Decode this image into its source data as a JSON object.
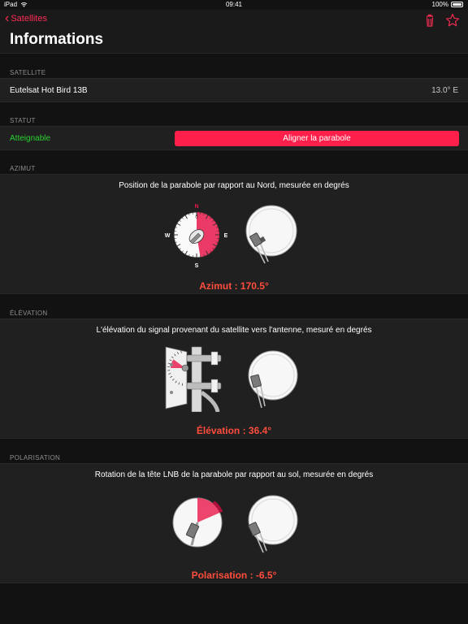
{
  "status_bar": {
    "device": "iPad",
    "time": "09:41",
    "battery": "100%"
  },
  "nav": {
    "back_label": "Satellites",
    "title": "Informations"
  },
  "satellite": {
    "section": "SATELLITE",
    "name": "Eutelsat Hot Bird 13B",
    "position": "13.0° E"
  },
  "status": {
    "section": "STATUT",
    "value": "Atteignable",
    "value_color": "#29d12e",
    "align_button": "Aligner la parabole"
  },
  "azimuth": {
    "section": "AZIMUT",
    "description": "Position de la parabole par rapport au Nord, mesurée en degrés",
    "compass": {
      "n": "N",
      "e": "E",
      "s": "S",
      "w": "W",
      "zero": "0"
    },
    "reading": "Azimut : 170.5°",
    "value_deg": 170.5
  },
  "elevation": {
    "section": "ÉLÉVATION",
    "description": "L'élévation du signal provenant du satellite vers l'antenne, mesuré en degrés",
    "reading": "Élévation : 36.4°",
    "value_deg": 36.4
  },
  "polarization": {
    "section": "POLARISATION",
    "description": "Rotation de la tête LNB de la parabole par rapport au sol, mesurée en degrés",
    "reading": "Polarisation : -6.5°",
    "value_deg": -6.5
  },
  "colors": {
    "accent": "#ff2d55",
    "button": "#ff1f4b",
    "reading": "#ff4d3d",
    "highlight": "#e8174a"
  }
}
